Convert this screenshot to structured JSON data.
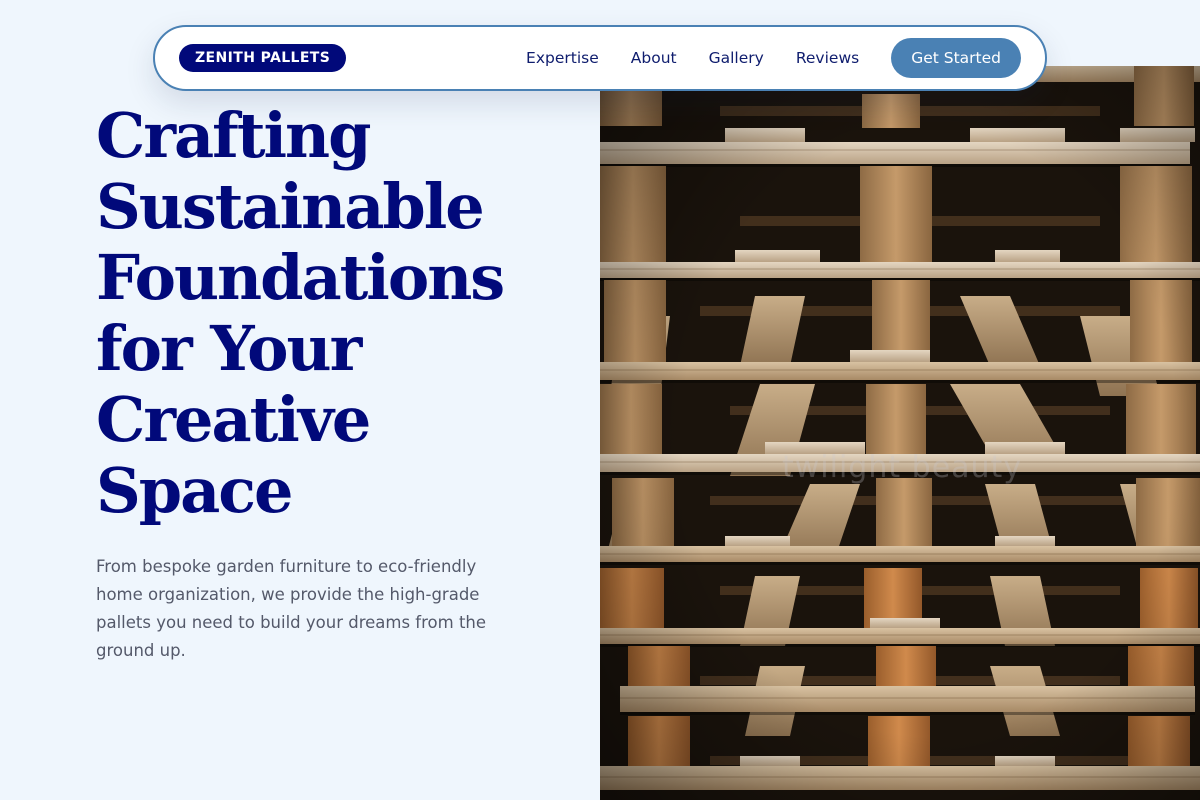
{
  "navbar": {
    "logo": "ZENITH PALLETS",
    "links": [
      {
        "label": "Expertise"
      },
      {
        "label": "About"
      },
      {
        "label": "Gallery"
      },
      {
        "label": "Reviews"
      }
    ],
    "cta_label": "Get Started"
  },
  "hero": {
    "title_lines": [
      "Crafting",
      "Sustainable",
      "Foundations",
      "for Your",
      "Creative",
      "Space"
    ],
    "subtitle": "From bespoke garden furniture to eco-friendly home organization, we provide the high-grade pallets you need to build your dreams from the ground up.",
    "image": {
      "subject": "stacked-wooden-pallets",
      "watermark": "twilight beauty"
    }
  },
  "colors": {
    "page_background": "#eff6fd",
    "brand_navy": "#01097a",
    "accent_blue": "#4a81b4",
    "nav_text": "#0f1d6e",
    "body_text": "#54596a"
  }
}
